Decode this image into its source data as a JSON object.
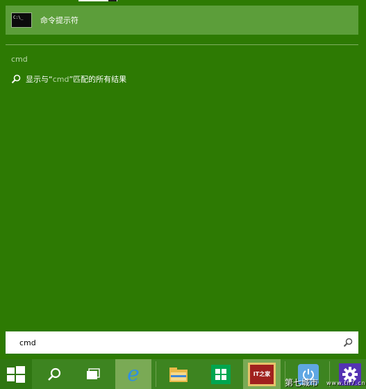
{
  "best_match": {
    "label": "命令提示符",
    "icon": "command-prompt-icon"
  },
  "results": {
    "section_header": "cmd",
    "web_result": {
      "prefix": "显示与“",
      "query": "cmd",
      "suffix": "”匹配的所有结果",
      "icon": "search-icon"
    }
  },
  "search": {
    "value": "cmd",
    "placeholder": "",
    "icon": "search-icon"
  },
  "taskbar": {
    "items": [
      {
        "name": "start",
        "icon": "windows-logo-icon"
      },
      {
        "name": "search",
        "icon": "search-icon"
      },
      {
        "name": "task-view",
        "icon": "task-view-icon"
      },
      {
        "name": "internet-explorer",
        "icon": "ie-icon",
        "active": true
      },
      {
        "name": "file-explorer",
        "icon": "folder-icon"
      },
      {
        "name": "store",
        "icon": "store-icon"
      },
      {
        "name": "ithome",
        "icon": "ithome-icon",
        "label": "IT之家"
      },
      {
        "name": "power",
        "icon": "power-icon"
      },
      {
        "name": "settings",
        "icon": "gear-icon"
      }
    ]
  },
  "watermark": {
    "text": "第七城市",
    "url": "www.th7.cn"
  },
  "colors": {
    "background": "#2d7a03",
    "selection": "#5c9e3a",
    "taskbar": "#3d8420",
    "accent_text": "#b9d7a6"
  }
}
